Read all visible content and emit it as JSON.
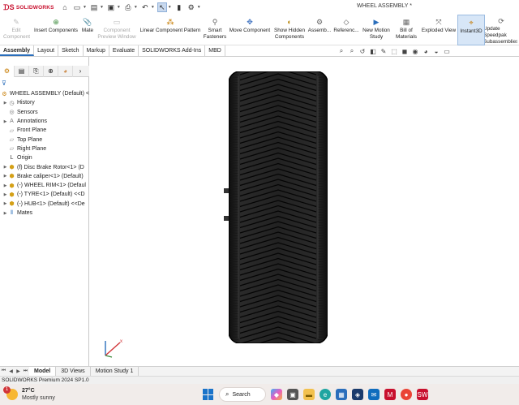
{
  "app": {
    "logo_text": "SOLIDWORKS",
    "window_title": "WHEEL ASSEMBLY *"
  },
  "ribbon": {
    "buttons": [
      {
        "label": "Edit Component",
        "enabled": false
      },
      {
        "label": "Insert Components",
        "enabled": true
      },
      {
        "label": "Mate",
        "enabled": true
      },
      {
        "label": "Component Preview Window",
        "enabled": false
      },
      {
        "label": "Linear Component Pattern",
        "enabled": true
      },
      {
        "label": "Smart Fasteners",
        "enabled": true
      },
      {
        "label": "Move Component",
        "enabled": true
      },
      {
        "label": "Show Hidden Components",
        "enabled": true
      },
      {
        "label": "Assemb...",
        "enabled": true
      },
      {
        "label": "Referenc...",
        "enabled": true
      },
      {
        "label": "New Motion Study",
        "enabled": true
      },
      {
        "label": "Bill of Materials",
        "enabled": true
      },
      {
        "label": "Exploded View",
        "enabled": true
      },
      {
        "label": "Instant3D",
        "enabled": true,
        "active": true
      },
      {
        "label": "Update Speedpak Subassemblies",
        "enabled": true
      }
    ]
  },
  "tabs": [
    "Assembly",
    "Layout",
    "Sketch",
    "Markup",
    "Evaluate",
    "SOLIDWORKS Add-Ins",
    "MBD"
  ],
  "active_tab": "Assembly",
  "tree": {
    "root": "WHEEL ASSEMBLY (Default) <",
    "items": [
      {
        "label": "History",
        "expandable": true,
        "icon": "history-icon"
      },
      {
        "label": "Sensors",
        "expandable": false,
        "icon": "sensor-icon"
      },
      {
        "label": "Annotations",
        "expandable": true,
        "icon": "annotations-icon"
      },
      {
        "label": "Front Plane",
        "expandable": false,
        "icon": "plane-icon"
      },
      {
        "label": "Top Plane",
        "expandable": false,
        "icon": "plane-icon"
      },
      {
        "label": "Right Plane",
        "expandable": false,
        "icon": "plane-icon"
      },
      {
        "label": "Origin",
        "expandable": false,
        "icon": "origin-icon"
      },
      {
        "label": "(f) Disc Brake Rotor<1> (D",
        "expandable": true,
        "icon": "part-icon"
      },
      {
        "label": "Brake caliper<1> (Default)",
        "expandable": true,
        "icon": "part-icon"
      },
      {
        "label": "(-) WHEEL RIM<1> (Defaul",
        "expandable": true,
        "icon": "part-icon"
      },
      {
        "label": "(-) TYRE<1> (Default) <<D",
        "expandable": true,
        "icon": "part-icon"
      },
      {
        "label": "(-) HUB<1> (Default) <<De",
        "expandable": true,
        "icon": "part-icon"
      },
      {
        "label": "Mates",
        "expandable": true,
        "icon": "mates-icon"
      }
    ]
  },
  "bottom_tabs": [
    "Model",
    "3D Views",
    "Motion Study 1"
  ],
  "active_bottom_tab": "Model",
  "status_text": "SOLIDWORKS Premium 2024 SP1.0",
  "taskbar": {
    "weather_badge": "1",
    "temperature": "27°C",
    "condition": "Mostly sunny",
    "search_label": "Search"
  },
  "colors": {
    "accent": "#2a6ebb",
    "brand": "#c8102e",
    "tyre": "#1c1c1c",
    "taskbar": "#f1ecea"
  }
}
